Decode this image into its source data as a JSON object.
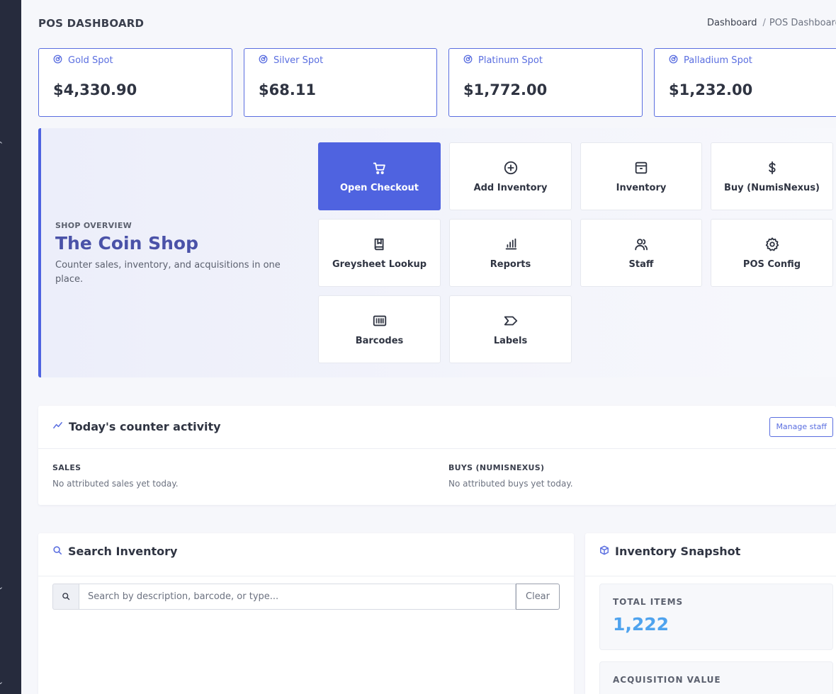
{
  "header": {
    "title": "POS DASHBOARD",
    "breadcrumb": [
      "Dashboard",
      "POS Dashboard"
    ]
  },
  "spots": [
    {
      "label": "Gold Spot",
      "value": "$4,330.90",
      "icon": "gauge-icon"
    },
    {
      "label": "Silver Spot",
      "value": "$68.11",
      "icon": "gauge-icon"
    },
    {
      "label": "Platinum Spot",
      "value": "$1,772.00",
      "icon": "gauge-icon"
    },
    {
      "label": "Palladium Spot",
      "value": "$1,232.00",
      "icon": "gauge-icon"
    }
  ],
  "overview": {
    "kicker": "SHOP OVERVIEW",
    "title": "The Coin Shop",
    "subtitle": "Counter sales, inventory, and acquisitions in one place."
  },
  "tiles": [
    {
      "label": "Open Checkout",
      "icon": "cart-icon",
      "primary": true
    },
    {
      "label": "Add Inventory",
      "icon": "plus-circle-icon"
    },
    {
      "label": "Inventory",
      "icon": "archive-icon"
    },
    {
      "label": "Buy (NumisNexus)",
      "icon": "dollar-icon"
    },
    {
      "label": "Greysheet Lookup",
      "icon": "book-icon"
    },
    {
      "label": "Reports",
      "icon": "bar-chart-icon"
    },
    {
      "label": "Staff",
      "icon": "users-icon"
    },
    {
      "label": "POS Config",
      "icon": "gear-icon"
    },
    {
      "label": "Barcodes",
      "icon": "barcode-icon"
    },
    {
      "label": "Labels",
      "icon": "tag-icon"
    }
  ],
  "activity": {
    "title": "Today's counter activity",
    "manage_label": "Manage staff",
    "sales_label": "SALES",
    "sales_text": "No attributed sales yet today.",
    "buys_label": "BUYS (NUMISNEXUS)",
    "buys_text": "No attributed buys yet today."
  },
  "search": {
    "title": "Search Inventory",
    "placeholder": "Search by description, barcode, or type...",
    "clear_label": "Clear"
  },
  "snapshot": {
    "title": "Inventory Snapshot",
    "total_label": "TOTAL ITEMS",
    "total_value": "1,222",
    "acq_label": "ACQUISITION VALUE"
  },
  "colors": {
    "accent": "#4f63e0",
    "sidebar": "#262b3d",
    "stat_value": "#4fa3ee"
  }
}
